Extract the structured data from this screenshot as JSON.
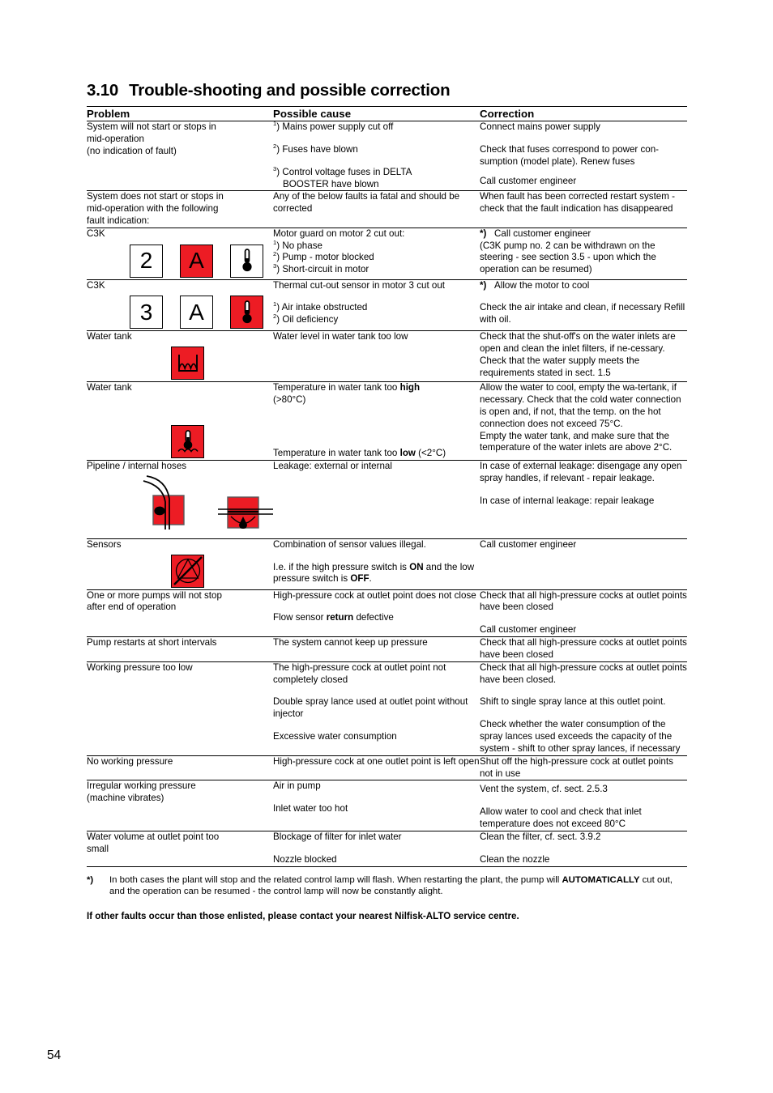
{
  "document": {
    "section_number": "3.10",
    "section_title": "Trouble-shooting and possible correction",
    "page_number": "54"
  },
  "table": {
    "headers": {
      "problem": "Problem",
      "cause": "Possible cause",
      "correction": "Correction"
    },
    "rows": [
      {
        "problem_lines": [
          "System will not start or stops in",
          "mid-operation",
          "(no indication of fault)"
        ],
        "causes": [
          {
            "marker": "1",
            "text": ") Mains power supply cut off"
          },
          {
            "marker": "2",
            "text": ") Fuses have blown"
          },
          {
            "marker": "3",
            "text": ") Control voltage fuses in DELTA",
            "text2": "BOOSTER have blown"
          }
        ],
        "corrections": [
          "Connect mains power supply",
          "Check that fuses correspond to power con-sumption (model plate). Renew fuses",
          "Call customer engineer"
        ]
      },
      {
        "problem_lines": [
          "System does not start or stops in",
          "mid-operation with the following",
          "fault indication:"
        ],
        "cause_text": "Any of the below faults ia fatal and should be corrected",
        "correction_text": "When fault has been corrected restart system - check that the fault indication has disappeared"
      },
      {
        "label": "C3K",
        "icons": [
          {
            "name": "display-digit-2",
            "glyph": "2",
            "red": false
          },
          {
            "name": "display-letter-a-alarm",
            "glyph": "A",
            "red": true
          },
          {
            "name": "thermometer-icon",
            "glyph": "thermometer",
            "red": false
          }
        ],
        "cause_title": "Motor guard on motor 2 cut out:",
        "causes": [
          {
            "marker": "1",
            "text": ") No phase"
          },
          {
            "marker": "2",
            "text": ") Pump - motor blocked"
          },
          {
            "marker": "3",
            "text": ") Short-circuit in motor"
          }
        ],
        "correction_star": "*)",
        "correction_star_text": "Call customer engineer",
        "correction_body": "(C3K pump no. 2 can be withdrawn on the steering - see section 3.5 - upon which the operation can be resumed)"
      },
      {
        "label": "C3K",
        "icons": [
          {
            "name": "display-digit-3",
            "glyph": "3",
            "red": false
          },
          {
            "name": "display-letter-a",
            "glyph": "A",
            "red": false
          },
          {
            "name": "thermometer-alarm-icon",
            "glyph": "thermometer",
            "red": true
          }
        ],
        "cause_text": "Thermal cut-out sensor in motor 3 cut out",
        "causes": [
          {
            "marker": "1",
            "text": ") Air intake obstructed"
          },
          {
            "marker": "2",
            "text": ") Oil deficiency"
          }
        ],
        "correction_star": "*)",
        "correction_star_text": "Allow the motor to cool",
        "correction_body": "Check the air intake and clean, if necessary Refill with oil."
      },
      {
        "label": "Water tank",
        "icon": {
          "name": "water-tank-low-level-icon",
          "red": true
        },
        "cause_text": "Water level in water tank too low",
        "correction_text": "Check that the shut-off's on the water inlets are open and clean the inlet filters, if ne-cessary. Check that the water supply meets the requirements stated in sect. 1.5"
      },
      {
        "label": "Water tank",
        "icon": {
          "name": "water-tank-temperature-icon",
          "red": true
        },
        "cause_high_pre": "Temperature in water tank too ",
        "cause_high_bold": "high",
        "cause_high_post": "(>80°C)",
        "cause_low_pre": "Temperature in water tank too ",
        "cause_low_bold": "low",
        "cause_low_post": " (<2°C)",
        "correction_high": "Allow the water to cool, empty the wa-tertank, if necessary. Check that the cold water connection is open and, if not, that the temp. on the hot connection does not exceed 75°C.",
        "correction_low": "Empty the water tank, and make sure that the temperature of the water inlets are above 2°C."
      },
      {
        "label": "Pipeline / internal hoses",
        "icons_pair": [
          {
            "name": "external-leakage-icon",
            "red": true
          },
          {
            "name": "internal-leakage-icon",
            "red": true
          }
        ],
        "cause_text": "Leakage: external or internal",
        "correction_1": "In case of external leakage: disengage any open spray handles, if relevant - repair leakage.",
        "correction_2": "In case of internal leakage: repair leakage"
      },
      {
        "label": "Sensors",
        "icon": {
          "name": "sensor-illegal-icon",
          "red": true
        },
        "cause_text": "Combination of sensor values illegal.",
        "cause_detail_pre": "I.e. if the high pressure switch is ",
        "cause_detail_bold1": "ON",
        "cause_detail_mid": " and the low pressure switch is ",
        "cause_detail_bold2": "OFF",
        "cause_detail_post": ".",
        "correction_text": "Call customer engineer"
      },
      {
        "problem_lines": [
          "One or more pumps will not stop",
          "after end of operation"
        ],
        "cause_1": "High-pressure cock at outlet point does not close",
        "cause_2_pre": "Flow sensor ",
        "cause_2_bold": "return",
        "cause_2_post": " defective",
        "correction_1": "Check that all high-pressure cocks at outlet points have been closed",
        "correction_2": "Call customer engineer"
      },
      {
        "problem_lines": [
          "Pump restarts at short intervals"
        ],
        "cause_text": "The system cannot keep up pressure",
        "correction_text": "Check that all high-pressure cocks at outlet points have been closed"
      },
      {
        "problem_lines": [
          "Working pressure too low"
        ],
        "cause_1": "The high-pressure cock at outlet point not completely closed",
        "cause_2": "Double spray lance used at outlet point without injector",
        "cause_3": "Excessive water consumption",
        "correction_1": "Check that all high-pressure cocks at outlet points have been closed.",
        "correction_2": "Shift to single spray lance at this outlet point.",
        "correction_3": "Check whether the water consumption of the spray lances used exceeds the capacity of the system - shift to other spray lances, if necessary"
      },
      {
        "problem_lines": [
          "No working pressure"
        ],
        "cause_text": "High-pressure cock at one outlet point is left open",
        "correction_text": "Shut off the high-pressure cock at outlet points not in use"
      },
      {
        "problem_lines": [
          "Irregular working pressure",
          "(machine vibrates)"
        ],
        "cause_1": "Air in pump",
        "cause_2": "Inlet water too hot",
        "correction_1": "Vent the system, cf. sect. 2.5.3",
        "correction_2": "Allow water to cool and check that inlet temperature does not exceed 80°C"
      },
      {
        "problem_lines": [
          "Water volume at outlet point too",
          "small"
        ],
        "cause_1": "Blockage of filter for inlet water",
        "cause_2": "Nozzle blocked",
        "correction_1": "Clean the filter, cf. sect. 3.9.2",
        "correction_2": "Clean the nozzle"
      }
    ]
  },
  "footnotes": {
    "star": "*)",
    "line1_pre": "In both cases the plant will stop and the related control lamp will flash. When restarting the plant, the pump will ",
    "line1_bold": "AUTOMATICALLY",
    "line1_post": " cut out, and the operation can be resumed - the control lamp will now be constantly alight.",
    "notice": "If other faults occur than those enlisted, please contact your nearest Nilfisk-ALTO service centre."
  },
  "colors": {
    "alarm_red": "#ED1C24",
    "text": "#000000"
  }
}
